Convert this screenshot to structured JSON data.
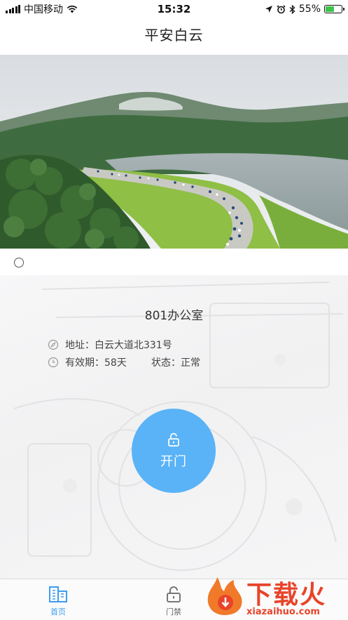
{
  "status_bar": {
    "carrier": "中国移动",
    "time": "15:32",
    "battery_percent": "55%",
    "battery_level": 0.55
  },
  "header": {
    "title": "平安白云"
  },
  "banner": {
    "active_index": 0,
    "count": 1
  },
  "room": {
    "name": "801办公室",
    "address_label": "地址：白云大道北331号",
    "validity_label": "有效期：58天",
    "status_label": "状态：正常"
  },
  "open_button": {
    "label": "开门",
    "color": "#5ab3f7"
  },
  "tabbar": {
    "tabs": [
      {
        "label": "首页",
        "icon": "building-icon",
        "active": true
      },
      {
        "label": "门禁",
        "icon": "lock-icon",
        "active": false
      }
    ],
    "active_color": "#3d9cf0"
  },
  "watermark": {
    "brand": "下载火",
    "domain": "xiazaihuo.com"
  }
}
